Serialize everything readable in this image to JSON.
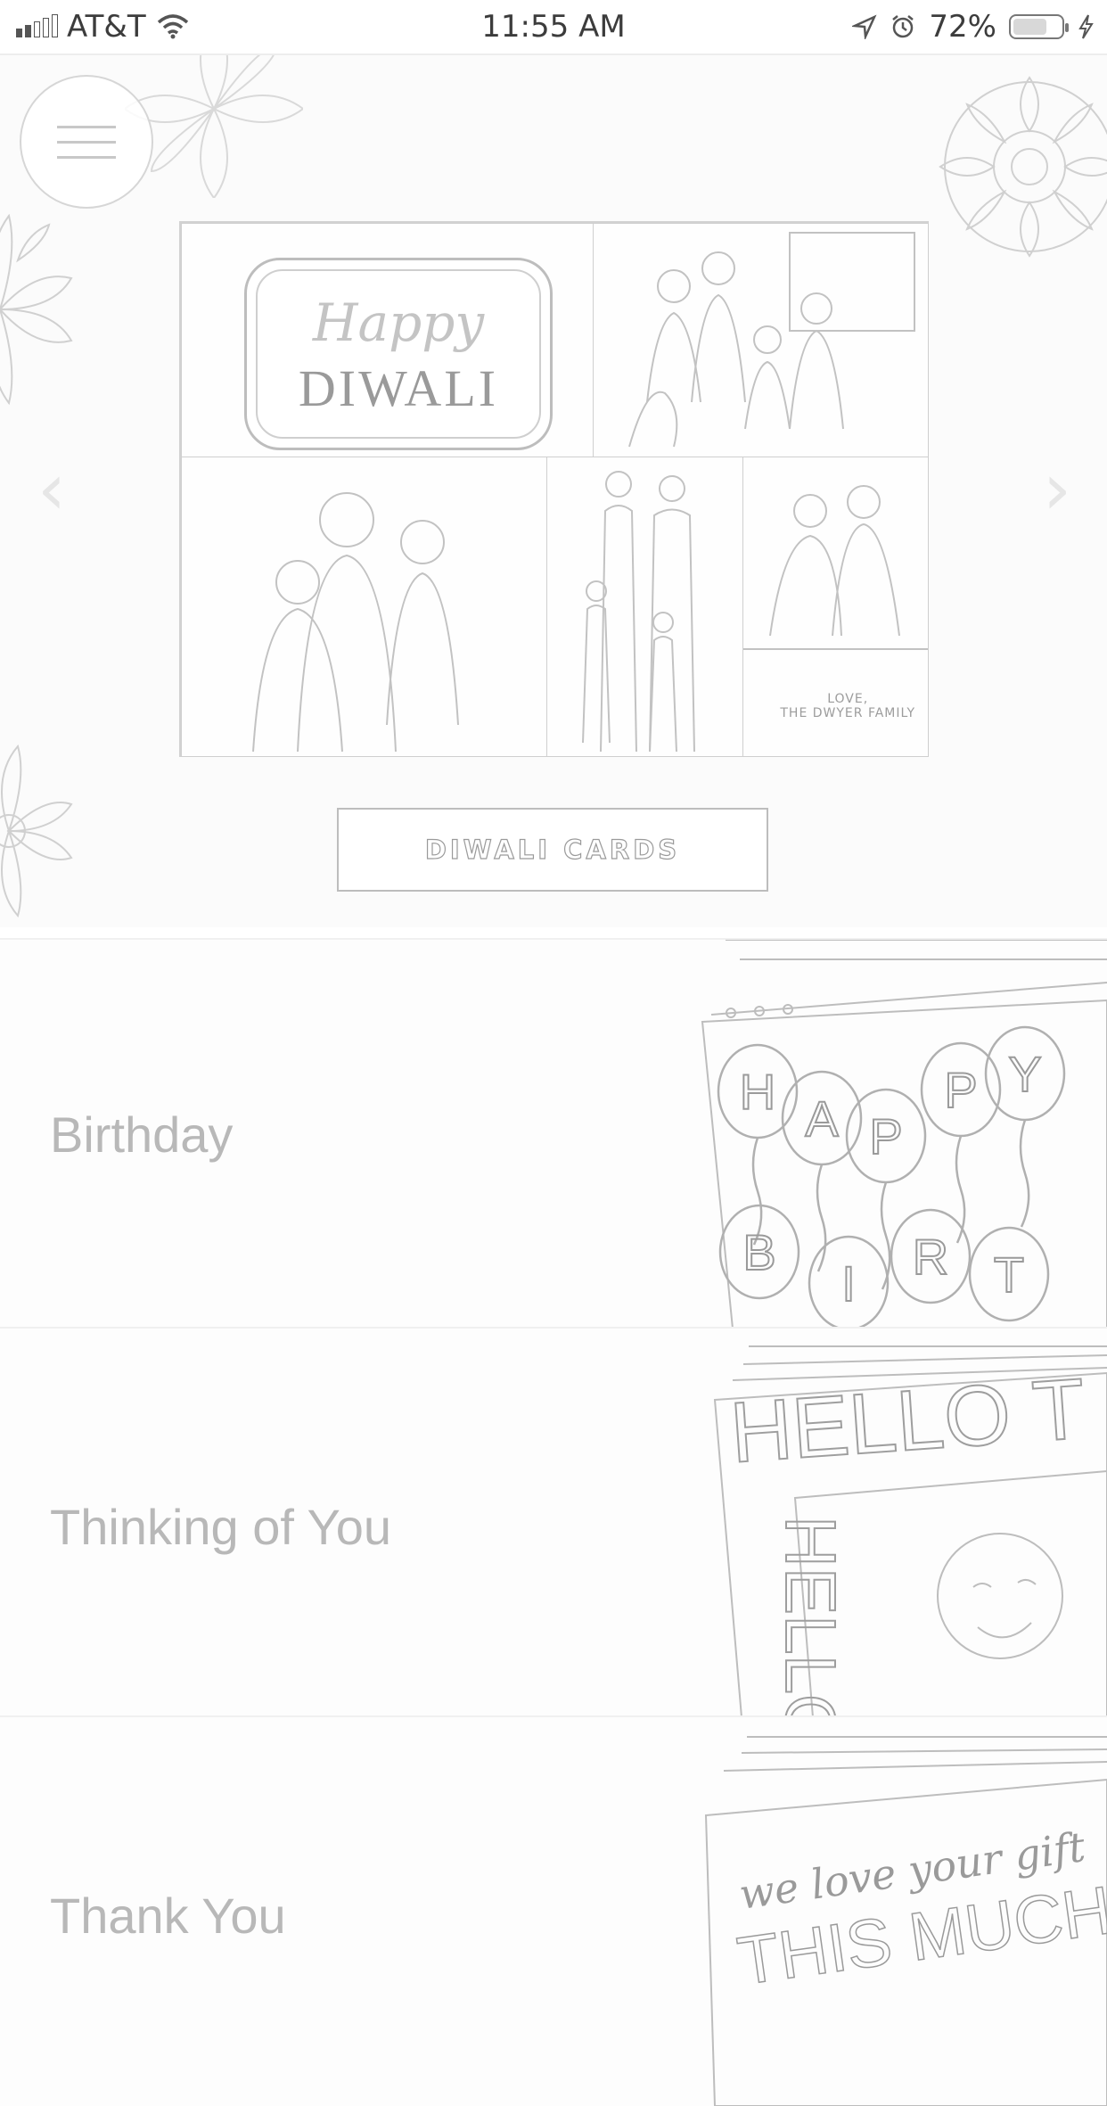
{
  "status_bar": {
    "carrier": "AT&T",
    "time": "11:55 AM",
    "battery_percent": "72%",
    "battery_level": 0.72,
    "icons": [
      "signal-bars-icon",
      "wifi-icon",
      "location-arrow-icon",
      "alarm-clock-icon",
      "battery-icon",
      "charging-bolt-icon"
    ]
  },
  "hero": {
    "menu_icon": "hamburger-menu-icon",
    "prev_icon": "chevron-left-icon",
    "next_icon": "chevron-right-icon",
    "card": {
      "script_text": "Happy",
      "headline_text": "DIWALI",
      "signoff_line1": "LOVE,",
      "signoff_line2": "THE DWYER FAMILY"
    },
    "cta_label": "DIWALI CARDS"
  },
  "categories": [
    {
      "label": "Birthday",
      "art_icon": "birthday-balloons-card-art"
    },
    {
      "label": "Thinking of You",
      "art_icon": "hello-photo-card-art"
    },
    {
      "label": "Thank You",
      "art_icon": "thank-you-card-art"
    }
  ],
  "category_art": {
    "balloon_letters": [
      "H",
      "A",
      "P",
      "P",
      "Y",
      "B",
      "I",
      "R",
      "T"
    ],
    "hello_text": "HELLO T",
    "hello_vertical": "HELLO",
    "thanks_script": "we love your gift",
    "thanks_caps": "THIS MUCH"
  },
  "colors": {
    "background": "#ffffff",
    "hero_background": "#fbfbfb",
    "outline": "#bdbdbd",
    "label_text": "#b8b8b8"
  }
}
